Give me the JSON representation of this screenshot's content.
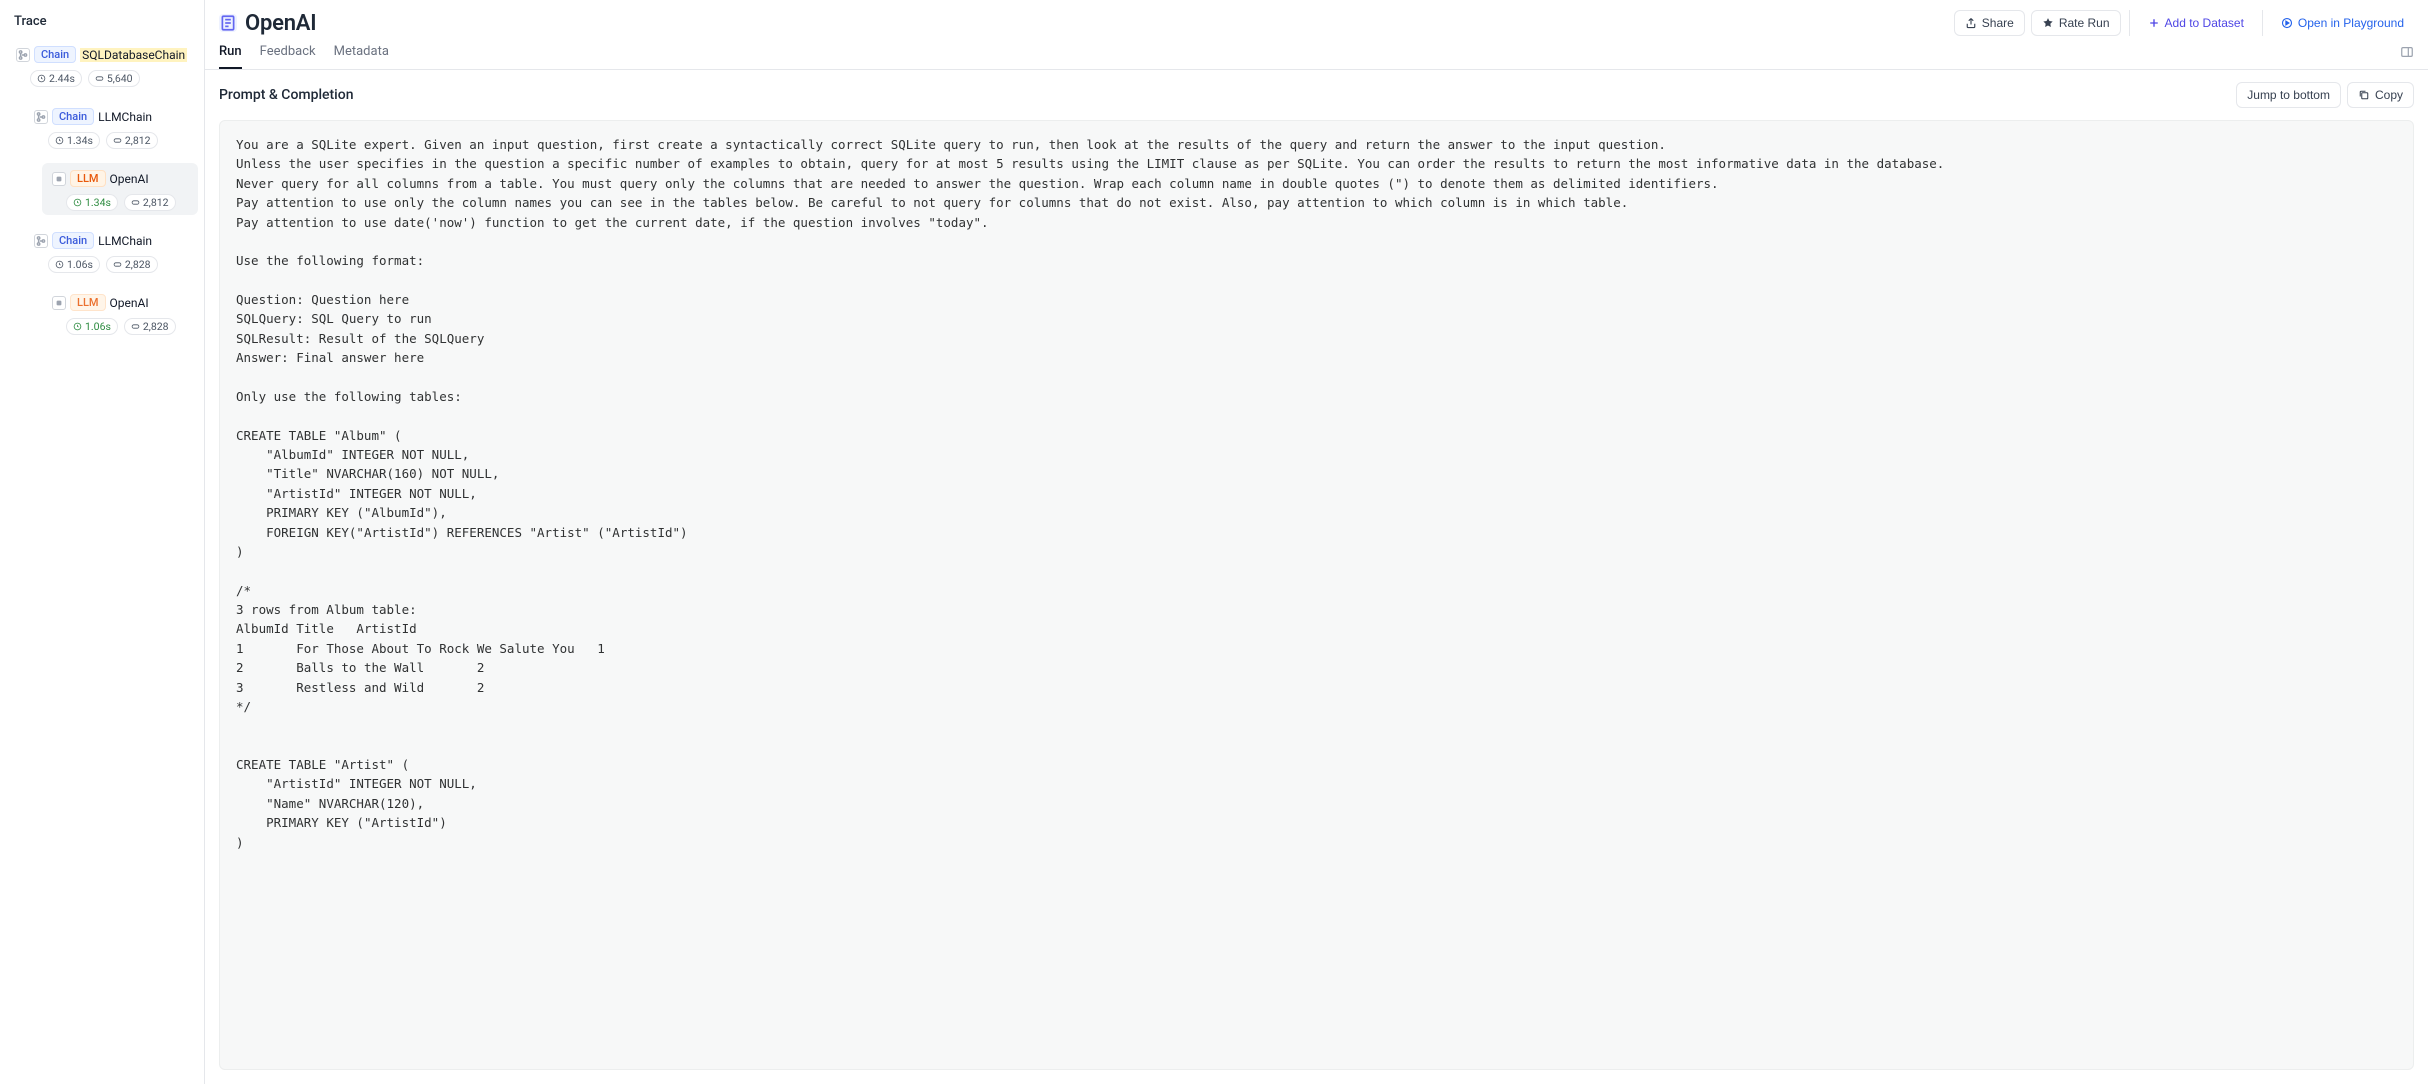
{
  "sidebar": {
    "title": "Trace",
    "nodes": [
      {
        "icon": "branch",
        "tag": "Chain",
        "tagClass": "tag-chain",
        "name": "SQLDatabaseChain",
        "nameHighlight": true,
        "time": "2.44s",
        "tokens": "5,640",
        "indent": 0,
        "selected": false
      },
      {
        "icon": "branch",
        "tag": "Chain",
        "tagClass": "tag-chain",
        "name": "LLMChain",
        "nameHighlight": false,
        "time": "1.34s",
        "tokens": "2,812",
        "indent": 1,
        "selected": false
      },
      {
        "icon": "leaf",
        "tag": "LLM",
        "tagClass": "tag-llm",
        "name": "OpenAI",
        "nameHighlight": false,
        "time": "1.34s",
        "tokens": "2,812",
        "indent": 2,
        "selected": true,
        "greenTime": true
      },
      {
        "icon": "branch",
        "tag": "Chain",
        "tagClass": "tag-chain",
        "name": "LLMChain",
        "nameHighlight": false,
        "time": "1.06s",
        "tokens": "2,828",
        "indent": 1,
        "selected": false
      },
      {
        "icon": "leaf",
        "tag": "LLM",
        "tagClass": "tag-llm dim",
        "name": "OpenAI",
        "nameHighlight": false,
        "time": "1.06s",
        "tokens": "2,828",
        "indent": 2,
        "selected": false,
        "greenTime": true
      }
    ]
  },
  "header": {
    "title": "OpenAI",
    "actions": {
      "share": "Share",
      "rate": "Rate Run",
      "add": "Add to Dataset",
      "open": "Open in Playground"
    }
  },
  "tabs": [
    "Run",
    "Feedback",
    "Metadata"
  ],
  "activeTab": 0,
  "section": {
    "title": "Prompt & Completion",
    "jump": "Jump to bottom",
    "copy": "Copy"
  },
  "prompt": "You are a SQLite expert. Given an input question, first create a syntactically correct SQLite query to run, then look at the results of the query and return the answer to the input question.\nUnless the user specifies in the question a specific number of examples to obtain, query for at most 5 results using the LIMIT clause as per SQLite. You can order the results to return the most informative data in the database.\nNever query for all columns from a table. You must query only the columns that are needed to answer the question. Wrap each column name in double quotes (\") to denote them as delimited identifiers.\nPay attention to use only the column names you can see in the tables below. Be careful to not query for columns that do not exist. Also, pay attention to which column is in which table.\nPay attention to use date('now') function to get the current date, if the question involves \"today\".\n\nUse the following format:\n\nQuestion: Question here\nSQLQuery: SQL Query to run\nSQLResult: Result of the SQLQuery\nAnswer: Final answer here\n\nOnly use the following tables:\n\nCREATE TABLE \"Album\" (\n    \"AlbumId\" INTEGER NOT NULL,\n    \"Title\" NVARCHAR(160) NOT NULL,\n    \"ArtistId\" INTEGER NOT NULL,\n    PRIMARY KEY (\"AlbumId\"),\n    FOREIGN KEY(\"ArtistId\") REFERENCES \"Artist\" (\"ArtistId\")\n)\n\n/*\n3 rows from Album table:\nAlbumId\tTitle\tArtistId\n1\tFor Those About To Rock We Salute You\t1\n2\tBalls to the Wall\t2\n3\tRestless and Wild\t2\n*/\n\n\nCREATE TABLE \"Artist\" (\n    \"ArtistId\" INTEGER NOT NULL,\n    \"Name\" NVARCHAR(120),\n    PRIMARY KEY (\"ArtistId\")\n)"
}
